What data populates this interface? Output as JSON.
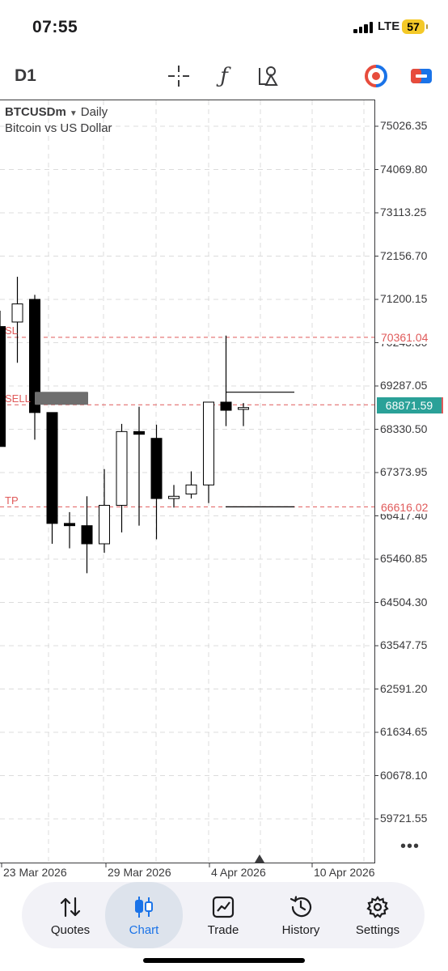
{
  "status_bar": {
    "time": "07:55",
    "network": "LTE",
    "battery": "57"
  },
  "toolbar": {
    "timeframe": "D1",
    "function_icon_glyph": "ƒ",
    "icons": [
      "crosshair-icon",
      "function-icon",
      "draw-objects-icon",
      "one-click-trading-icon",
      "trade-icon"
    ]
  },
  "chart": {
    "symbol": "BTCUSDm",
    "period": "Daily",
    "description": "Bitcoin vs US Dollar",
    "sl_label": "SL",
    "sl_price": "70361.04",
    "sell_label": "SELL",
    "sell_price": "68871.59",
    "tp_label": "TP",
    "tp_price": "66616.02",
    "more_glyph": "•••",
    "colors": {
      "level_line": "#e05a5a",
      "bid_tag": "#2aa198",
      "bear": "#000000",
      "bull": "#ffffff"
    }
  },
  "chart_data": {
    "type": "candlestick",
    "y_ticks": [
      "75026.35",
      "74069.80",
      "73113.25",
      "72156.70",
      "71200.15",
      "70243.60",
      "69287.05",
      "68330.50",
      "67373.95",
      "66417.40",
      "65460.85",
      "64504.30",
      "63547.75",
      "62591.20",
      "61634.65",
      "60678.10",
      "59721.55"
    ],
    "x_ticks": [
      "23 Mar 2026",
      "29 Mar 2026",
      "4 Apr 2026",
      "10 Apr 2026"
    ],
    "grid": true,
    "candles": [
      {
        "o": 70600,
        "h": 70950,
        "l": 67950,
        "c": 67950
      },
      {
        "o": 70700,
        "h": 71700,
        "l": 69800,
        "c": 71100
      },
      {
        "o": 71200,
        "h": 71300,
        "l": 68100,
        "c": 68700
      },
      {
        "o": 68700,
        "h": 68700,
        "l": 65800,
        "c": 66250
      },
      {
        "o": 66250,
        "h": 66500,
        "l": 65700,
        "c": 66200
      },
      {
        "o": 66200,
        "h": 66850,
        "l": 65150,
        "c": 65800
      },
      {
        "o": 65800,
        "h": 67450,
        "l": 65600,
        "c": 66650
      },
      {
        "o": 66650,
        "h": 68450,
        "l": 66050,
        "c": 68280
      },
      {
        "o": 68280,
        "h": 68830,
        "l": 66200,
        "c": 68220
      },
      {
        "o": 68130,
        "h": 68430,
        "l": 65900,
        "c": 66800
      },
      {
        "o": 66800,
        "h": 67100,
        "l": 66600,
        "c": 66850
      },
      {
        "o": 66900,
        "h": 67400,
        "l": 66800,
        "c": 67100
      },
      {
        "o": 67100,
        "h": 68930,
        "l": 66700,
        "c": 68930
      },
      {
        "o": 68930,
        "h": 70400,
        "l": 68400,
        "c": 68750
      },
      {
        "o": 68770,
        "h": 68910,
        "l": 68400,
        "c": 68810
      }
    ],
    "levels": [
      {
        "name": "SL",
        "price": 70361.04
      },
      {
        "name": "SELL",
        "price": 68871.59
      },
      {
        "name": "TP",
        "price": 66616.02
      }
    ]
  },
  "tabs": [
    {
      "label": "Quotes",
      "active": false
    },
    {
      "label": "Chart",
      "active": true
    },
    {
      "label": "Trade",
      "active": false
    },
    {
      "label": "History",
      "active": false
    },
    {
      "label": "Settings",
      "active": false
    }
  ]
}
